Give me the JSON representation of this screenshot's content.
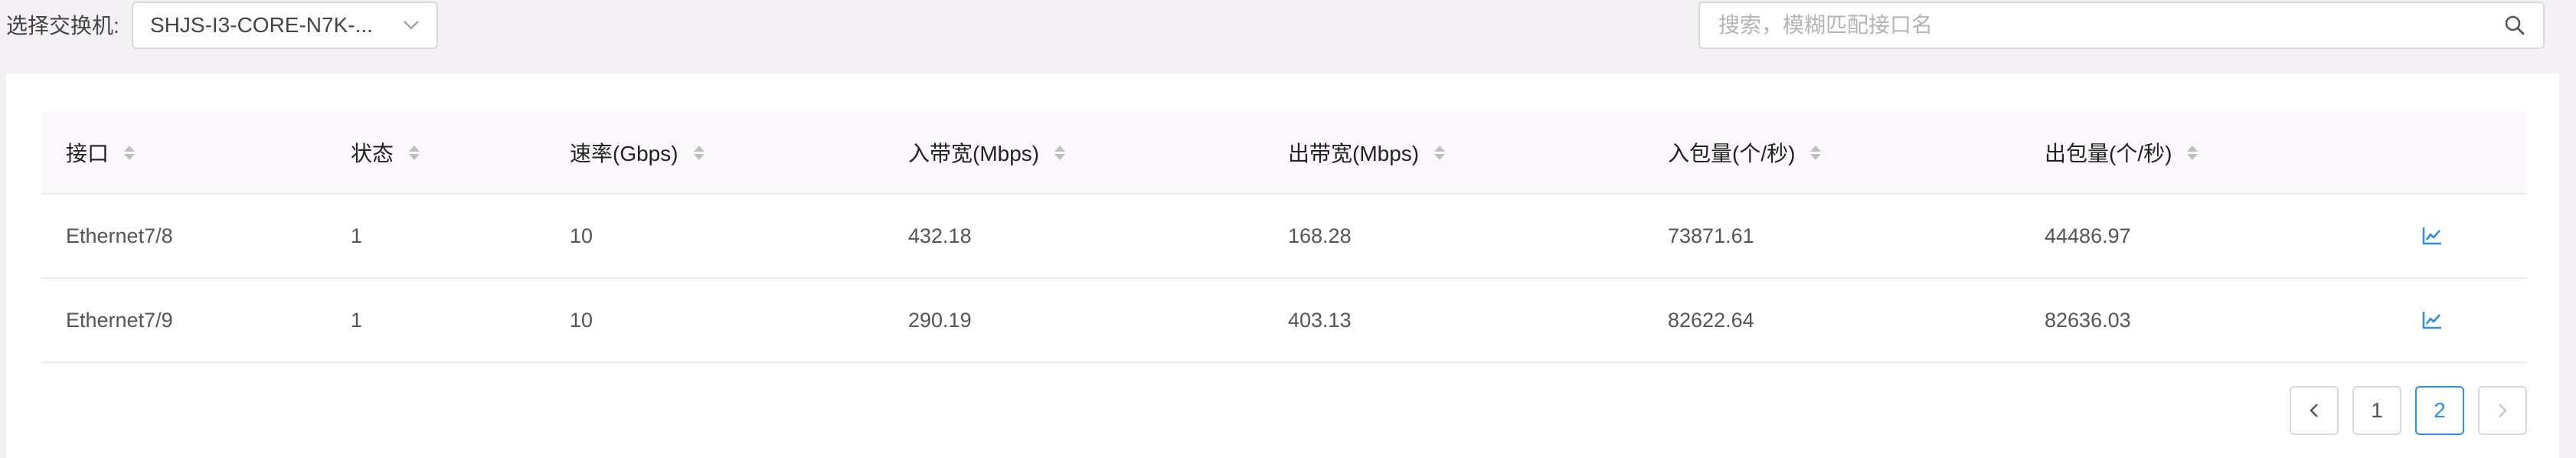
{
  "toolbar": {
    "switch_label": "选择交换机:",
    "switch_value": "SHJS-I3-CORE-N7K-...",
    "search_placeholder": "搜索，模糊匹配接口名"
  },
  "table": {
    "columns": [
      "接口",
      "状态",
      "速率(Gbps)",
      "入带宽(Mbps)",
      "出带宽(Mbps)",
      "入包量(个/秒)",
      "出包量(个/秒)"
    ],
    "rows": [
      [
        "Ethernet7/8",
        "1",
        "10",
        "432.18",
        "168.28",
        "73871.61",
        "44486.97"
      ],
      [
        "Ethernet7/9",
        "1",
        "10",
        "290.19",
        "403.13",
        "82622.64",
        "82636.03"
      ]
    ]
  },
  "pagination": {
    "pages": [
      "1",
      "2"
    ],
    "current": "2"
  },
  "colors": {
    "accent": "#2f8fe8",
    "page_background": "#f3f1f4",
    "header_background": "#fbf8fb"
  },
  "icons": {
    "dropdown": "chevron-down-icon",
    "search": "search-icon",
    "sort": "sort-icon",
    "row_action": "line-chart-icon",
    "prev": "chevron-left-icon",
    "next": "chevron-right-icon"
  }
}
